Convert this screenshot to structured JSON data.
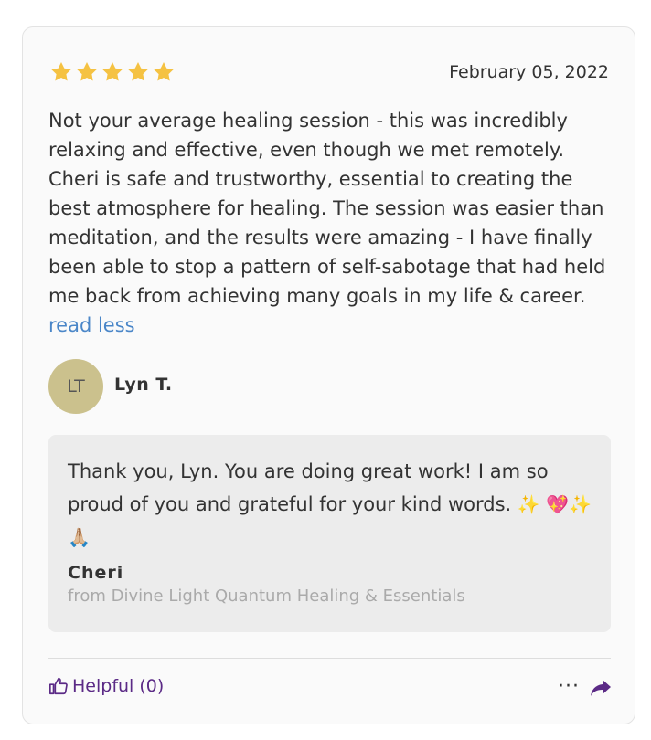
{
  "review": {
    "rating": 5,
    "rating_max": 5,
    "date": "February 05, 2022",
    "body": "Not your average healing session - this was incredibly relaxing and effective, even though we met remotely. Cheri is safe and trustworthy, essential to creating the best atmosphere for healing. The session was easier than meditation, and the results were amazing - I have finally been able to stop a pattern of self-sabotage that had held me back from achieving many goals in my life & career.",
    "read_less_label": "read less",
    "author_initials": "LT",
    "author_name": "Lyn T."
  },
  "reply": {
    "text": "Thank you, Lyn. You are doing great work! I am so proud of you and grateful for your kind words.",
    "emojis": "✨ 💖✨🙏🏼",
    "author": "Cheri",
    "from": "from Divine Light Quantum Healing & Essentials"
  },
  "footer": {
    "helpful_label": "Helpful (0)",
    "more_label": "···"
  },
  "colors": {
    "star": "#f5c242",
    "link": "#4a86c8",
    "helpful": "#5b2a86",
    "avatar": "#cbc18d",
    "reply_bg": "#ececec"
  },
  "icons": [
    "star-icon",
    "thumbs-up-icon",
    "more-icon",
    "share-arrow-icon"
  ]
}
